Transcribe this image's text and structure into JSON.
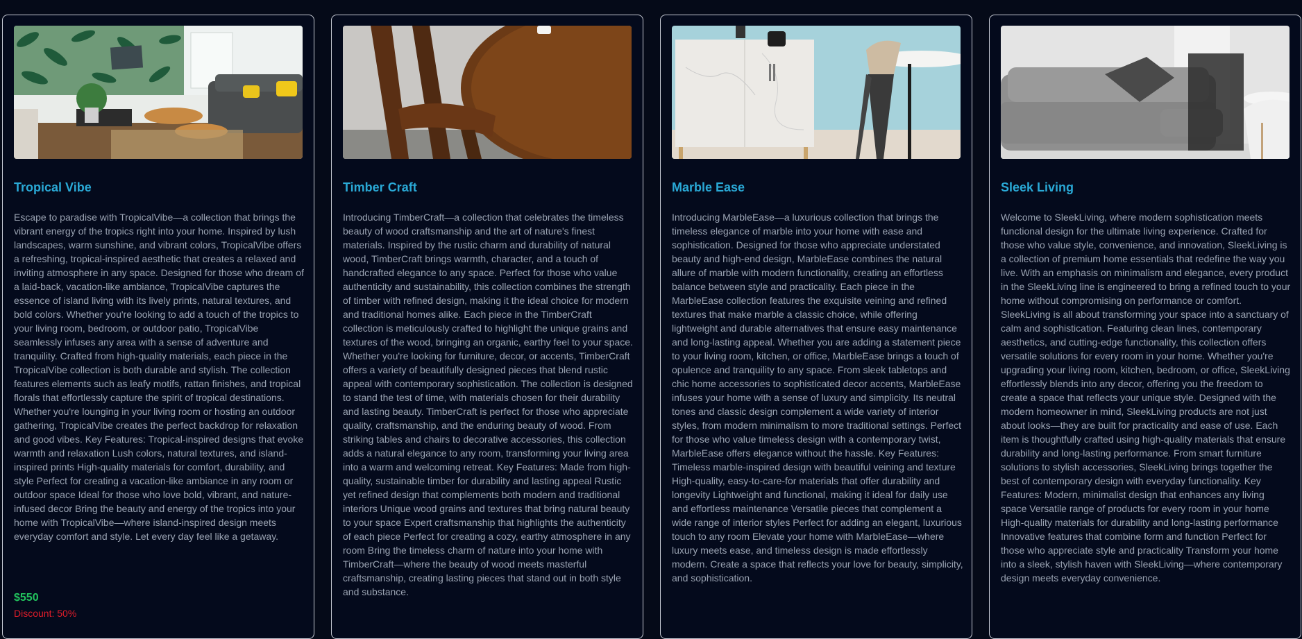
{
  "products": [
    {
      "title": "Tropical Vibe",
      "image_label": "tropical-living-room-photo",
      "description": "Escape to paradise with TropicalVibe—a collection that brings the vibrant energy of the tropics right into your home. Inspired by lush landscapes, warm sunshine, and vibrant colors, TropicalVibe offers a refreshing, tropical-inspired aesthetic that creates a relaxed and inviting atmosphere in any space. Designed for those who dream of a laid-back, vacation-like ambiance, TropicalVibe captures the essence of island living with its lively prints, natural textures, and bold colors. Whether you're looking to add a touch of the tropics to your living room, bedroom, or outdoor patio, TropicalVibe seamlessly infuses any area with a sense of adventure and tranquility. Crafted from high-quality materials, each piece in the TropicalVibe collection is both durable and stylish. The collection features elements such as leafy motifs, rattan finishes, and tropical florals that effortlessly capture the spirit of tropical destinations. Whether you're lounging in your living room or hosting an outdoor gathering, TropicalVibe creates the perfect backdrop for relaxation and good vibes. Key Features: Tropical-inspired designs that evoke warmth and relaxation Lush colors, natural textures, and island-inspired prints High-quality materials for comfort, durability, and style Perfect for creating a vacation-like ambiance in any room or outdoor space Ideal for those who love bold, vibrant, and nature-infused decor Bring the beauty and energy of the tropics into your home with TropicalVibe—where island-inspired design meets everyday comfort and style. Let every day feel like a getaway.",
      "price": "$550",
      "discount": "Discount: 50%"
    },
    {
      "title": "Timber Craft",
      "image_label": "wooden-chair-table-photo",
      "description": "Introducing TimberCraft—a collection that celebrates the timeless beauty of wood craftsmanship and the art of nature's finest materials. Inspired by the rustic charm and durability of natural wood, TimberCraft brings warmth, character, and a touch of handcrafted elegance to any space. Perfect for those who value authenticity and sustainability, this collection combines the strength of timber with refined design, making it the ideal choice for modern and traditional homes alike. Each piece in the TimberCraft collection is meticulously crafted to highlight the unique grains and textures of the wood, bringing an organic, earthy feel to your space. Whether you're looking for furniture, decor, or accents, TimberCraft offers a variety of beautifully designed pieces that blend rustic appeal with contemporary sophistication. The collection is designed to stand the test of time, with materials chosen for their durability and lasting beauty. TimberCraft is perfect for those who appreciate quality, craftsmanship, and the enduring beauty of wood. From striking tables and chairs to decorative accessories, this collection adds a natural elegance to any room, transforming your living area into a warm and welcoming retreat. Key Features: Made from high-quality, sustainable timber for durability and lasting appeal Rustic yet refined design that complements both modern and traditional interiors Unique wood grains and textures that bring natural beauty to your space Expert craftsmanship that highlights the authenticity of each piece Perfect for creating a cozy, earthy atmosphere in any room Bring the timeless charm of nature into your home with TimberCraft—where the beauty of wood meets masterful craftsmanship, creating lasting pieces that stand out in both style and substance.",
      "price": "",
      "discount": ""
    },
    {
      "title": "Marble Ease",
      "image_label": "marble-cabinet-stool-photo",
      "description": "Introducing MarbleEase—a luxurious collection that brings the timeless elegance of marble into your home with ease and sophistication. Designed for those who appreciate understated beauty and high-end design, MarbleEase combines the natural allure of marble with modern functionality, creating an effortless balance between style and practicality. Each piece in the MarbleEase collection features the exquisite veining and refined textures that make marble a classic choice, while offering lightweight and durable alternatives that ensure easy maintenance and long-lasting appeal. Whether you are adding a statement piece to your living room, kitchen, or office, MarbleEase brings a touch of opulence and tranquility to any space. From sleek tabletops and chic home accessories to sophisticated decor accents, MarbleEase infuses your home with a sense of luxury and simplicity. Its neutral tones and classic design complement a wide variety of interior styles, from modern minimalism to more traditional settings. Perfect for those who value timeless design with a contemporary twist, MarbleEase offers elegance without the hassle. Key Features: Timeless marble-inspired design with beautiful veining and texture High-quality, easy-to-care-for materials that offer durability and longevity Lightweight and functional, making it ideal for daily use and effortless maintenance Versatile pieces that complement a wide range of interior styles Perfect for adding an elegant, luxurious touch to any room Elevate your home with MarbleEase—where luxury meets ease, and timeless design is made effortlessly modern. Create a space that reflects your love for beauty, simplicity, and sophistication.",
      "price": "",
      "discount": ""
    },
    {
      "title": "Sleek Living",
      "image_label": "grey-sofa-photo",
      "description": "Welcome to SleekLiving, where modern sophistication meets functional design for the ultimate living experience. Crafted for those who value style, convenience, and innovation, SleekLiving is a collection of premium home essentials that redefine the way you live. With an emphasis on minimalism and elegance, every product in the SleekLiving line is engineered to bring a refined touch to your home without compromising on performance or comfort. SleekLiving is all about transforming your space into a sanctuary of calm and sophistication. Featuring clean lines, contemporary aesthetics, and cutting-edge functionality, this collection offers versatile solutions for every room in your home. Whether you're upgrading your living room, kitchen, bedroom, or office, SleekLiving effortlessly blends into any decor, offering you the freedom to create a space that reflects your unique style. Designed with the modern homeowner in mind, SleekLiving products are not just about looks—they are built for practicality and ease of use. Each item is thoughtfully crafted using high-quality materials that ensure durability and long-lasting performance. From smart furniture solutions to stylish accessories, SleekLiving brings together the best of contemporary design with everyday functionality. Key Features: Modern, minimalist design that enhances any living space Versatile range of products for every room in your home High-quality materials for durability and long-lasting performance Innovative features that combine form and function Perfect for those who appreciate style and practicality Transform your home into a sleek, stylish haven with SleekLiving—where contemporary design meets everyday convenience.",
      "price": "",
      "discount": ""
    }
  ],
  "colors": {
    "background": "#050a18",
    "card_border": "#c8ccd6",
    "title": "#2aa9d6",
    "body_text": "#9aa3b2",
    "price": "#22c55e",
    "discount": "#e11d2a"
  }
}
